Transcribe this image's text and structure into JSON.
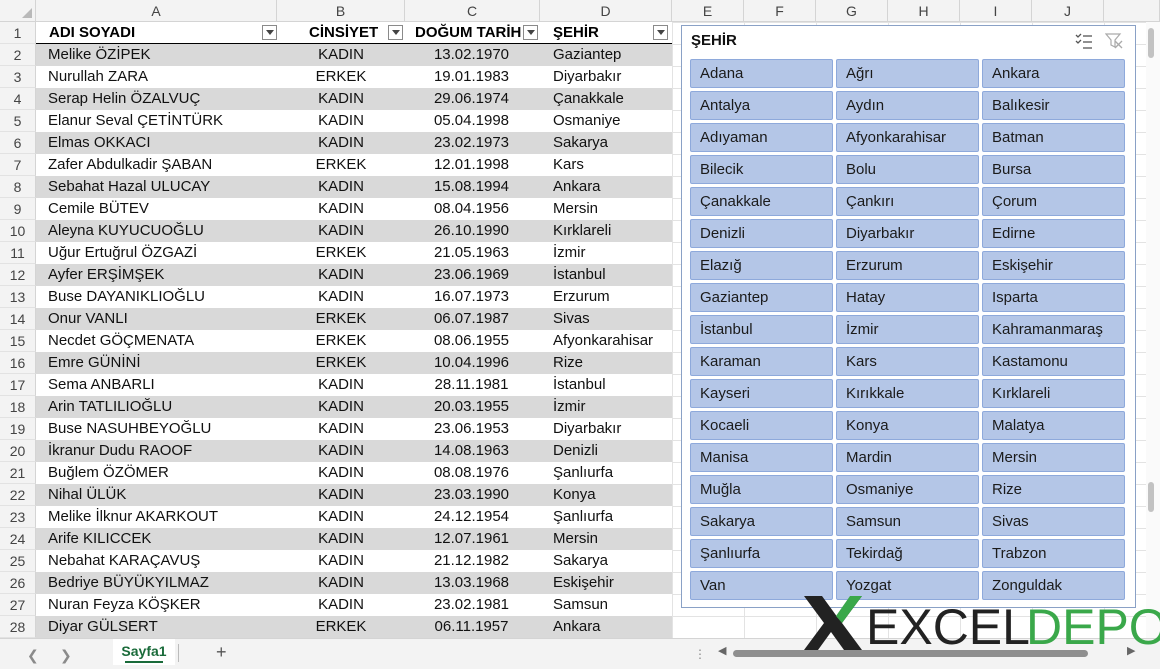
{
  "columns": [
    "A",
    "B",
    "C",
    "D",
    "E",
    "F",
    "G",
    "H",
    "I",
    "J"
  ],
  "header": {
    "name": "ADI SOYADI",
    "gender": "CİNSİYET",
    "birth": "DOĞUM TARİH",
    "city": "ŞEHİR"
  },
  "rows": [
    {
      "n": "2",
      "name": "Melike ÖZİPEK",
      "gender": "KADIN",
      "birth": "13.02.1970",
      "city": "Gaziantep"
    },
    {
      "n": "3",
      "name": "Nurullah ZARA",
      "gender": "ERKEK",
      "birth": "19.01.1983",
      "city": "Diyarbakır"
    },
    {
      "n": "4",
      "name": "Serap Helin ÖZALVUÇ",
      "gender": "KADIN",
      "birth": "29.06.1974",
      "city": "Çanakkale"
    },
    {
      "n": "5",
      "name": "Elanur Seval ÇETİNTÜRK",
      "gender": "KADIN",
      "birth": "05.04.1998",
      "city": "Osmaniye"
    },
    {
      "n": "6",
      "name": "Elmas OKKACI",
      "gender": "KADIN",
      "birth": "23.02.1973",
      "city": "Sakarya"
    },
    {
      "n": "7",
      "name": "Zafer Abdulkadir ŞABAN",
      "gender": "ERKEK",
      "birth": "12.01.1998",
      "city": "Kars"
    },
    {
      "n": "8",
      "name": "Sebahat Hazal ULUCAY",
      "gender": "KADIN",
      "birth": "15.08.1994",
      "city": "Ankara"
    },
    {
      "n": "9",
      "name": "Cemile BÜTEV",
      "gender": "KADIN",
      "birth": "08.04.1956",
      "city": "Mersin"
    },
    {
      "n": "10",
      "name": "Aleyna KUYUCUOĞLU",
      "gender": "KADIN",
      "birth": "26.10.1990",
      "city": "Kırklareli"
    },
    {
      "n": "11",
      "name": "Uğur Ertuğrul ÖZGAZİ",
      "gender": "ERKEK",
      "birth": "21.05.1963",
      "city": "İzmir"
    },
    {
      "n": "12",
      "name": "Ayfer ERŞİMŞEK",
      "gender": "KADIN",
      "birth": "23.06.1969",
      "city": "İstanbul"
    },
    {
      "n": "13",
      "name": "Buse DAYANIKLIOĞLU",
      "gender": "KADIN",
      "birth": "16.07.1973",
      "city": "Erzurum"
    },
    {
      "n": "14",
      "name": "Onur VANLI",
      "gender": "ERKEK",
      "birth": "06.07.1987",
      "city": "Sivas"
    },
    {
      "n": "15",
      "name": "Necdet GÖÇMENATA",
      "gender": "ERKEK",
      "birth": "08.06.1955",
      "city": "Afyonkarahisar"
    },
    {
      "n": "16",
      "name": "Emre GÜNİNİ",
      "gender": "ERKEK",
      "birth": "10.04.1996",
      "city": "Rize"
    },
    {
      "n": "17",
      "name": "Sema ANBARLI",
      "gender": "KADIN",
      "birth": "28.11.1981",
      "city": "İstanbul"
    },
    {
      "n": "18",
      "name": "Arin TATLILIOĞLU",
      "gender": "KADIN",
      "birth": "20.03.1955",
      "city": "İzmir"
    },
    {
      "n": "19",
      "name": "Buse NASUHBEYOĞLU",
      "gender": "KADIN",
      "birth": "23.06.1953",
      "city": "Diyarbakır"
    },
    {
      "n": "20",
      "name": "İkranur Dudu RAOOF",
      "gender": "KADIN",
      "birth": "14.08.1963",
      "city": "Denizli"
    },
    {
      "n": "21",
      "name": "Buğlem ÖZÖMER",
      "gender": "KADIN",
      "birth": "08.08.1976",
      "city": "Şanlıurfa"
    },
    {
      "n": "22",
      "name": "Nihal ÜLÜK",
      "gender": "KADIN",
      "birth": "23.03.1990",
      "city": "Konya"
    },
    {
      "n": "23",
      "name": "Melike İlknur AKARKOUT",
      "gender": "KADIN",
      "birth": "24.12.1954",
      "city": "Şanlıurfa"
    },
    {
      "n": "24",
      "name": "Arife KILICCEK",
      "gender": "KADIN",
      "birth": "12.07.1961",
      "city": "Mersin"
    },
    {
      "n": "25",
      "name": "Nebahat KARAÇAVUŞ",
      "gender": "KADIN",
      "birth": "21.12.1982",
      "city": "Sakarya"
    },
    {
      "n": "26",
      "name": "Bedriye BÜYÜKYILMAZ",
      "gender": "KADIN",
      "birth": "13.03.1968",
      "city": "Eskişehir"
    },
    {
      "n": "27",
      "name": "Nuran Feyza KÖŞKER",
      "gender": "KADIN",
      "birth": "23.02.1981",
      "city": "Samsun"
    },
    {
      "n": "28",
      "name": "Diyar GÜLSERT",
      "gender": "ERKEK",
      "birth": "06.11.1957",
      "city": "Ankara"
    }
  ],
  "slicer": {
    "title": "ŞEHİR",
    "items": [
      "Adana",
      "Ağrı",
      "Ankara",
      "Antalya",
      "Aydın",
      "Balıkesir",
      "Adıyaman",
      "Afyonkarahisar",
      "Batman",
      "Bilecik",
      "Bolu",
      "Bursa",
      "Çanakkale",
      "Çankırı",
      "Çorum",
      "Denizli",
      "Diyarbakır",
      "Edirne",
      "Elazığ",
      "Erzurum",
      "Eskişehir",
      "Gaziantep",
      "Hatay",
      "Isparta",
      "İstanbul",
      "İzmir",
      "Kahramanmaraş",
      "Karaman",
      "Kars",
      "Kastamonu",
      "Kayseri",
      "Kırıkkale",
      "Kırklareli",
      "Kocaeli",
      "Konya",
      "Malatya",
      "Manisa",
      "Mardin",
      "Mersin",
      "Muğla",
      "Osmaniye",
      "Rize",
      "Sakarya",
      "Samsun",
      "Sivas",
      "Şanlıurfa",
      "Tekirdağ",
      "Trabzon",
      "Van",
      "Yozgat",
      "Zonguldak"
    ],
    "button_color": "#b4c6e7",
    "border_color": "#8ea9db"
  },
  "sheet_tab": "Sayfa1",
  "logo": {
    "x": "X",
    "excel": "EXCEL",
    "depo": "DEPO",
    "green": "#3aa84a",
    "dark": "#222222"
  },
  "colors": {
    "band": "#d9d9d9",
    "tab_green": "#1a6b3a"
  }
}
